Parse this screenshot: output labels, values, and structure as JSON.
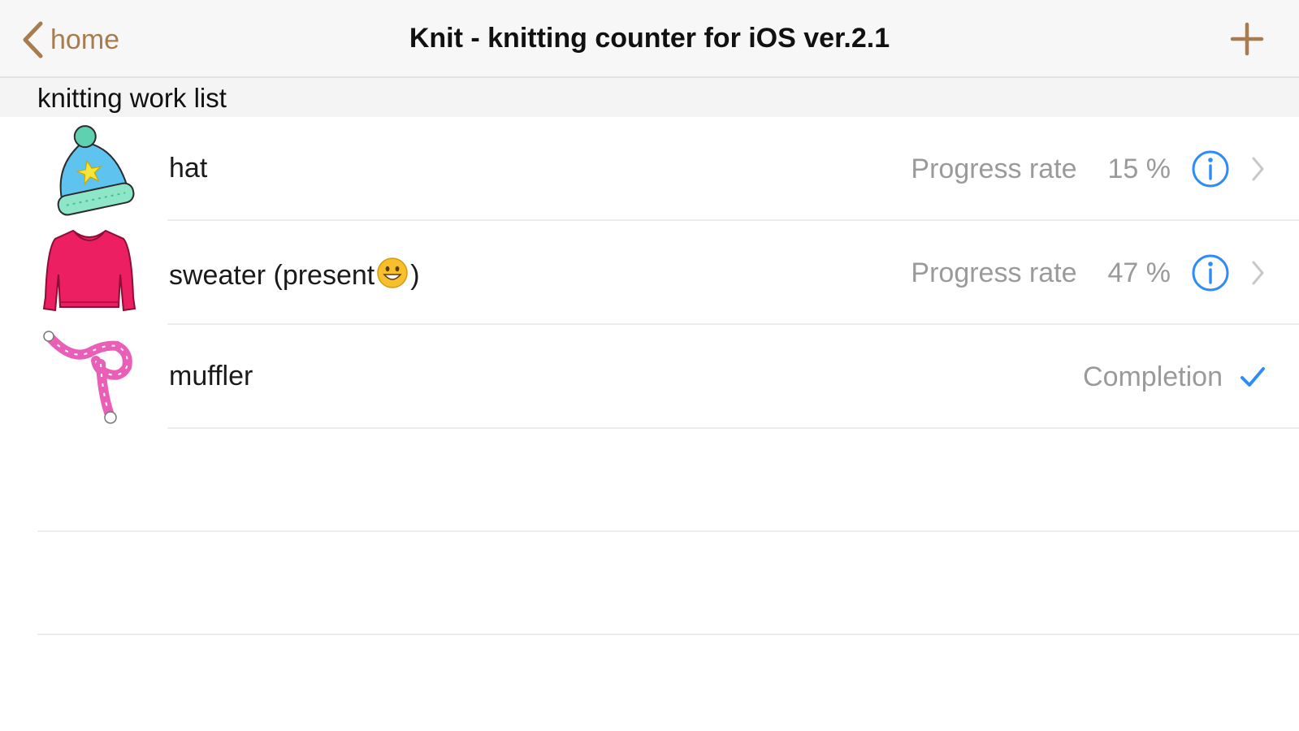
{
  "nav": {
    "back_label": "home",
    "title": "Knit - knitting counter for iOS ver.2.1"
  },
  "section": {
    "title": "knitting work list"
  },
  "items": [
    {
      "title": "hat",
      "status": "Progress rate",
      "percent": "15 %",
      "icon": "hat-icon",
      "progress": 0.15
    },
    {
      "title_before": "sweater (present",
      "title_after": ")",
      "emoji": "grinning-face-emoji",
      "status": "Progress rate",
      "percent": "47 %",
      "icon": "sweater-icon",
      "progress": 0.47
    },
    {
      "title": "muffler",
      "status": "Completion",
      "icon": "muffler-icon",
      "completed": true
    }
  ],
  "colors": {
    "accent": "#a87c4f",
    "info_blue": "#2f8cf5",
    "secondary_text": "#9a9a9a",
    "separator": "#ececec"
  }
}
